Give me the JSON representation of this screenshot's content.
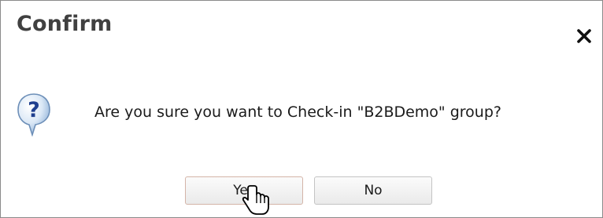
{
  "dialog": {
    "title": "Confirm",
    "message": "Are you sure you want to Check-in \"B2BDemo\" group?",
    "icon": "question-icon",
    "close_icon": "close-icon",
    "buttons": {
      "yes_label": "Yes",
      "no_label": "No"
    }
  },
  "cursor": "hand-pointer-cursor"
}
